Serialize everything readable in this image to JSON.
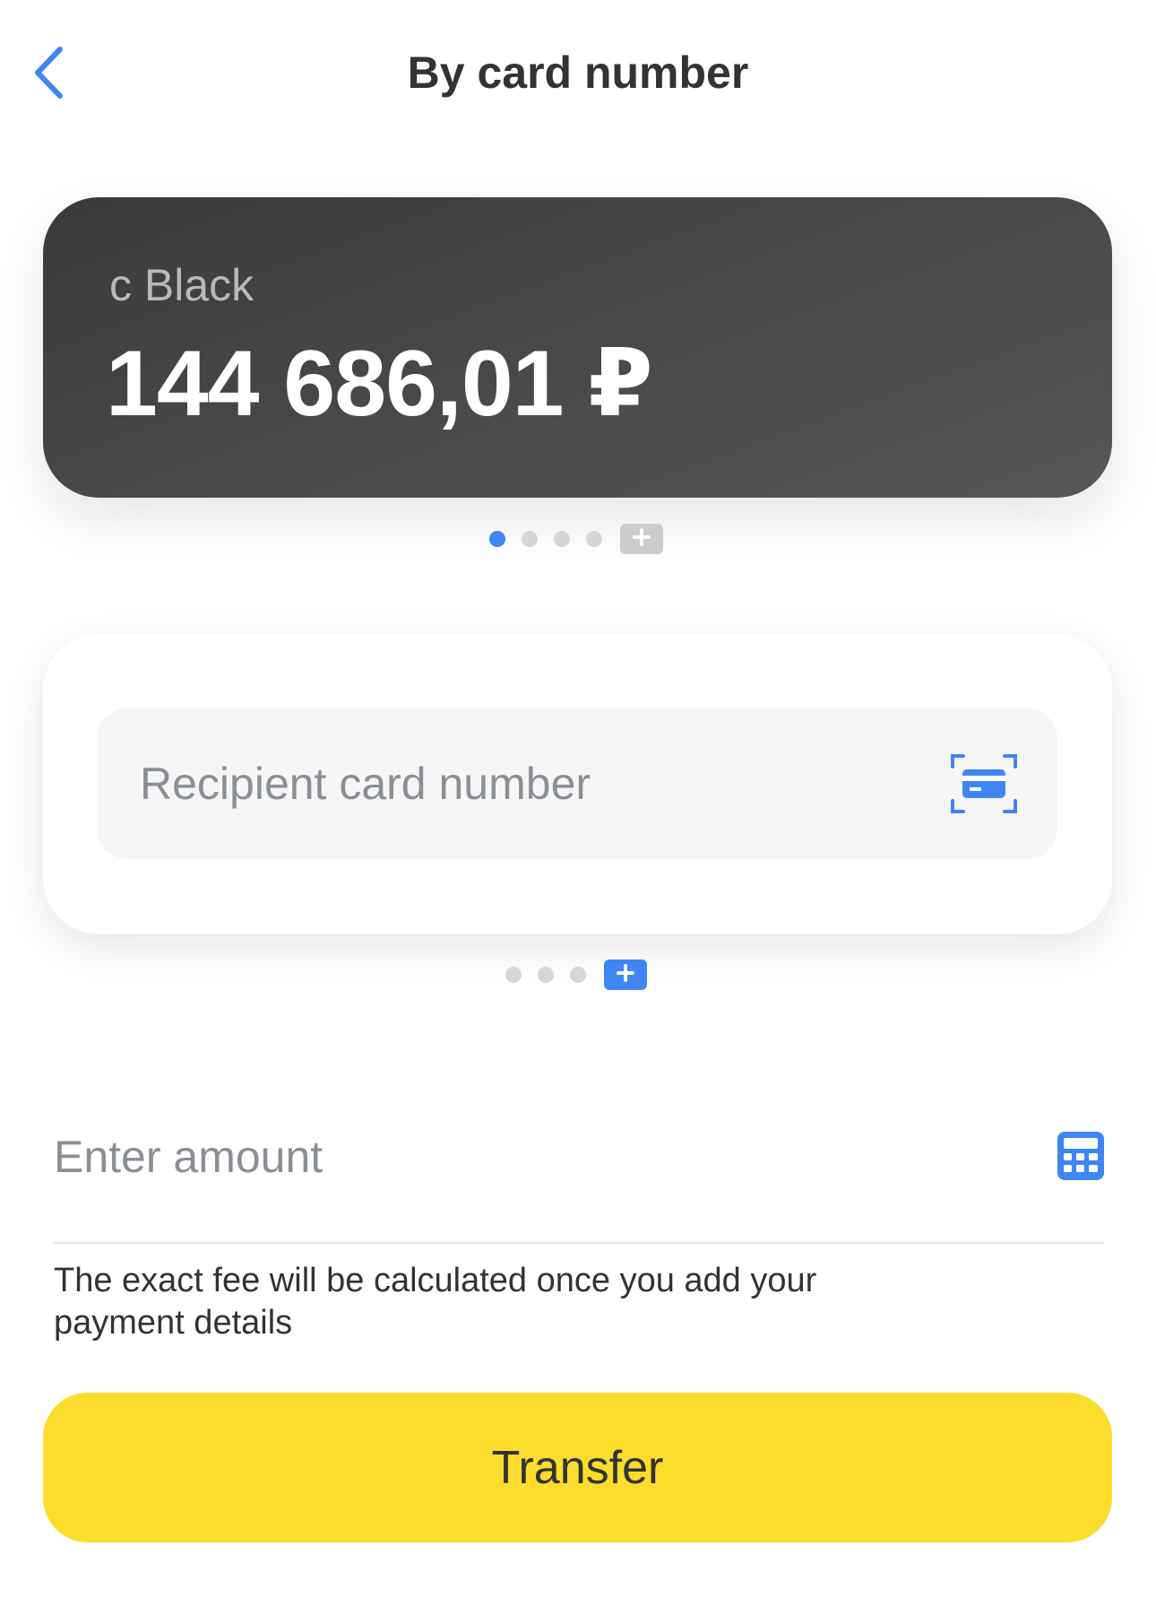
{
  "header": {
    "title": "By card number",
    "back_icon": "chevron-left-icon"
  },
  "source_card": {
    "name": "с Black",
    "balance": "144 686,01 ₽",
    "pager": {
      "dot_count": 4,
      "active_index": 0,
      "add_icon": "plus-icon"
    }
  },
  "recipient": {
    "placeholder": "Recipient card number",
    "value": "",
    "scan_icon": "scan-card-icon",
    "pager": {
      "dot_count": 3,
      "add_icon": "plus-icon"
    }
  },
  "amount": {
    "placeholder": "Enter amount",
    "value": "",
    "calculator_icon": "calculator-icon"
  },
  "fee_note": "The exact fee will be calculated once you add your payment details",
  "transfer_button": {
    "label": "Transfer"
  },
  "colors": {
    "accent_blue": "#3f86f2",
    "primary_yellow": "#fddd2c",
    "card_dark": "#474747",
    "placeholder_gray": "#8a8f96",
    "text_dark": "#333333"
  }
}
